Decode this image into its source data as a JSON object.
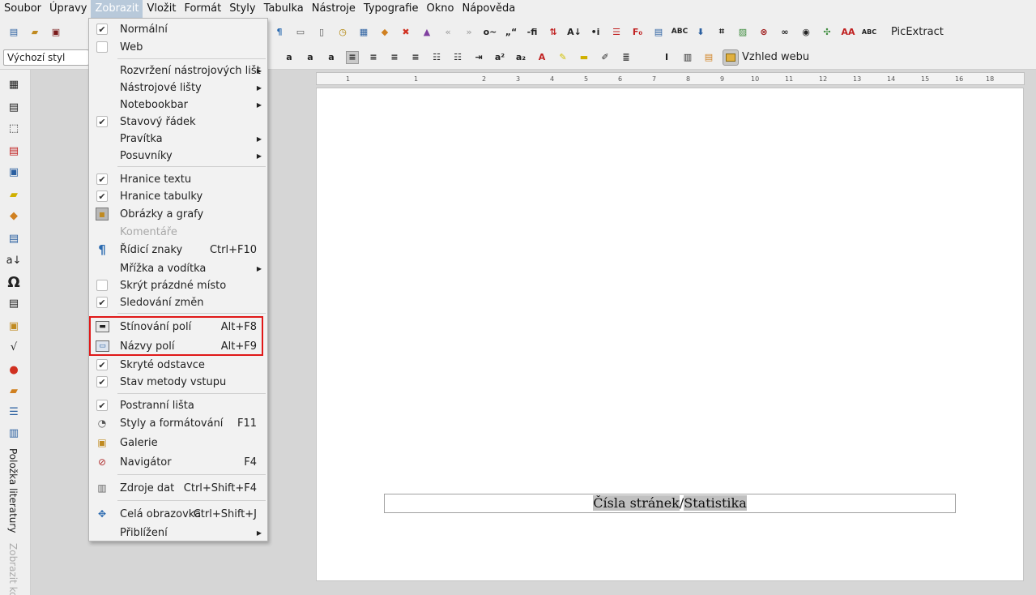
{
  "menubar": {
    "items": [
      "Soubor",
      "Úpravy",
      "Zobrazit",
      "Vložit",
      "Formát",
      "Styly",
      "Tabulka",
      "Nástroje",
      "Typografie",
      "Okno",
      "Nápověda"
    ]
  },
  "toolbar": {
    "picextract_label": "PicExtract",
    "style_value": "Výchozí styl",
    "web_view_label": "Vzhled webu"
  },
  "sidebar": {
    "bibliography_label": "Položka literatury",
    "show_label": "Zobrazit ko"
  },
  "ruler": {
    "ticks": [
      "1",
      "1",
      "2",
      "3",
      "4",
      "5",
      "6",
      "7",
      "8",
      "9",
      "10",
      "11",
      "12",
      "13",
      "14",
      "15",
      "16",
      "17",
      "18"
    ]
  },
  "document": {
    "footer_field1": "Čísla stránek",
    "footer_sep": "/",
    "footer_field2": "Statistika"
  },
  "view_menu": {
    "normal": "Normální",
    "web": "Web",
    "toolbar_layout": "Rozvržení nástrojových lišt",
    "toolbars": "Nástrojové lišty",
    "notebookbar": "Notebookbar",
    "status_bar": "Stavový řádek",
    "rulers": "Pravítka",
    "scrollbars": "Posuvníky",
    "text_boundaries": "Hranice textu",
    "table_boundaries": "Hranice tabulky",
    "images_charts": "Obrázky a grafy",
    "comments": "Komentáře",
    "formatting_marks": "Řídicí znaky",
    "formatting_marks_sc": "Ctrl+F10",
    "grid_guides": "Mřížka a vodítka",
    "hide_whitespace": "Skrýt prázdné místo",
    "track_changes": "Sledování změn",
    "field_shadings": "Stínování polí",
    "field_shadings_sc": "Alt+F8",
    "field_names": "Názvy polí",
    "field_names_sc": "Alt+F9",
    "hidden_paragraphs": "Skryté odstavce",
    "input_method": "Stav metody vstupu",
    "sidebar": "Postranní lišta",
    "styles": "Styly a formátování",
    "styles_sc": "F11",
    "gallery": "Galerie",
    "navigator": "Navigátor",
    "navigator_sc": "F4",
    "data_sources": "Zdroje dat",
    "data_sources_sc": "Ctrl+Shift+F4",
    "full_screen": "Celá obrazovka",
    "full_screen_sc": "Ctrl+Shift+J",
    "zoom": "Přiblížení"
  },
  "colors": {
    "highlight": "#e01818",
    "menu_active": "#b8c9da"
  }
}
